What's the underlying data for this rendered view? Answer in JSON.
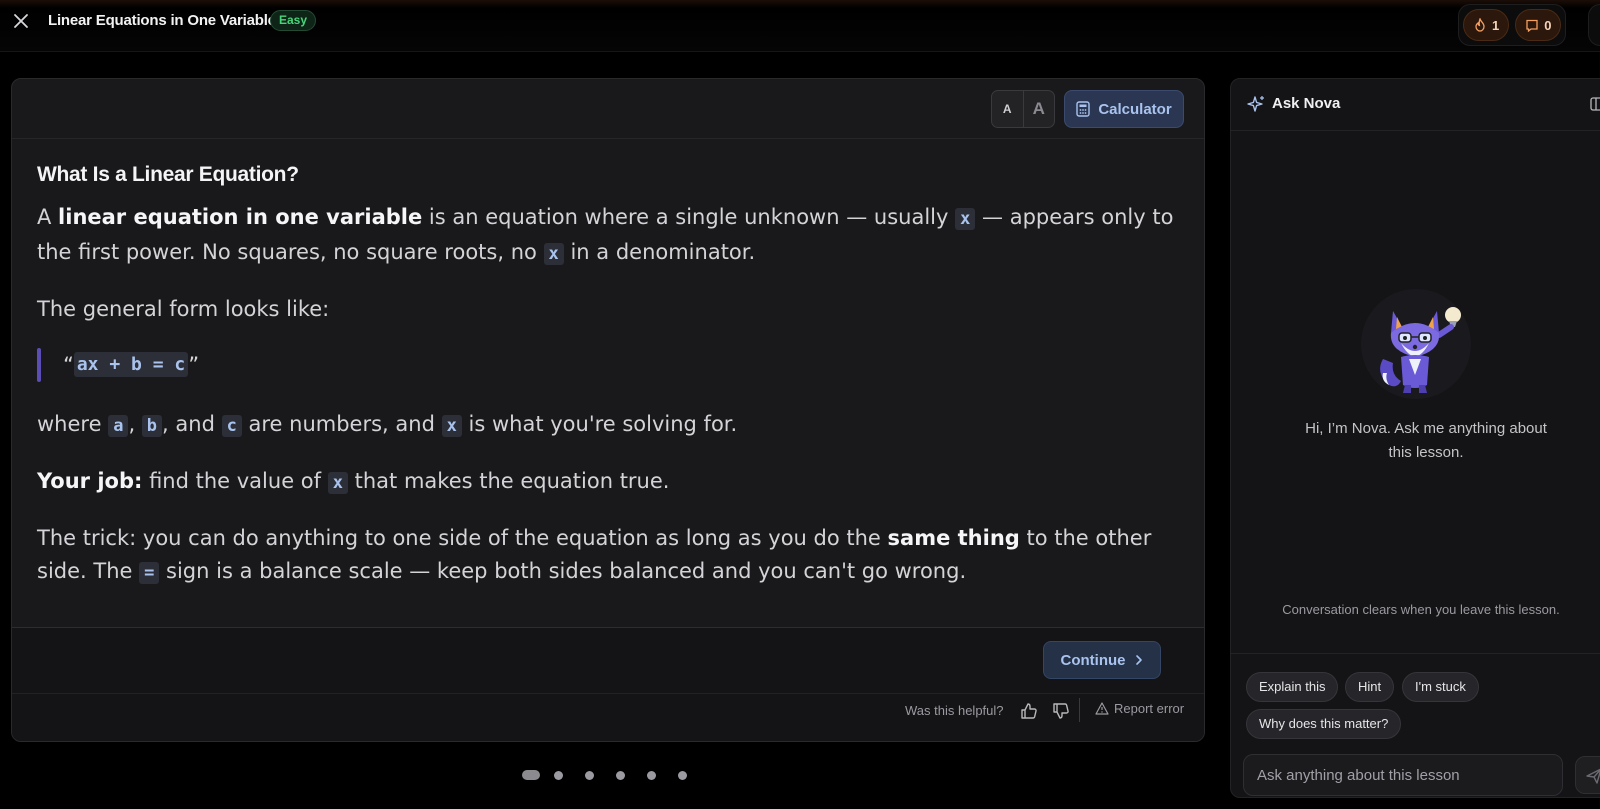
{
  "header": {
    "lesson_title": "Linear Equations in One Variable",
    "difficulty": "Easy",
    "streak_count": "1",
    "saved_count": "0"
  },
  "toolbar": {
    "font_small_label": "A",
    "font_large_label": "A",
    "calculator_label": "Calculator"
  },
  "lesson": {
    "heading": "What Is a Linear Equation?",
    "p1": {
      "t1": "A ",
      "b1": "linear equation in one variable",
      "t2": " is an equation where a single unknown — usually ",
      "c1": "x",
      "t3": " — appears only to the first power. No squares, no square roots, no ",
      "c2": "x",
      "t4": " in a denominator."
    },
    "p2": "The general form looks like:",
    "quote": {
      "open": "“",
      "code": "ax + b = c",
      "close": "”"
    },
    "p3": {
      "t1": "where ",
      "c1": "a",
      "t2": ", ",
      "c2": "b",
      "t3": ", and ",
      "c3": "c",
      "t4": " are numbers, and ",
      "c4": "x",
      "t5": " is what you're solving for."
    },
    "p4": {
      "b1": "Your job:",
      "t1": " find the value of ",
      "c1": "x",
      "t2": " that makes the equation true."
    },
    "p5": {
      "t1": "The trick: you can do anything to one side of the equation as long as you do the ",
      "b1": "same thing",
      "t2": " to the other side. The ",
      "c1": "=",
      "t3": " sign is a balance scale — keep both sides balanced and you can't go wrong."
    }
  },
  "footer": {
    "continue_label": "Continue",
    "helpful_label": "Was this helpful?",
    "report_label": "Report error"
  },
  "pagination": {
    "total": 6,
    "current": 1
  },
  "nova": {
    "title": "Ask Nova",
    "greeting": "Hi, I’m Nova. Ask me anything about this lesson.",
    "note": "Conversation clears when you leave this lesson.",
    "chips": [
      "Explain this",
      "Hint",
      "I'm stuck",
      "Why does this matter?"
    ],
    "input_placeholder": "Ask anything about this lesson"
  },
  "colors": {
    "accent": "#a9c3ee",
    "difficulty_green": "#47d47a",
    "streak_orange": "#f4a061",
    "quote_bar": "#5a4db5",
    "mascot_purple": "#6b5ad6"
  },
  "icons": [
    "close-icon",
    "flame-icon",
    "bookmark-icon",
    "calculator-icon",
    "chevron-right-icon",
    "thumbs-up-icon",
    "thumbs-down-icon",
    "warning-icon",
    "sparkle-icon",
    "collapse-panel-icon",
    "send-icon"
  ]
}
